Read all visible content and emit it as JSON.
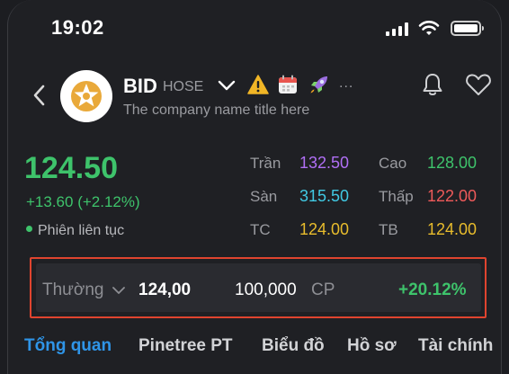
{
  "status_bar": {
    "time": "19:02"
  },
  "header": {
    "ticker": "BID",
    "exchange": "HOSE",
    "company_name": "The company name title here",
    "more": "..."
  },
  "quote": {
    "price": "124.50",
    "change": "+13.60 (+2.12%)",
    "session": "Phiên liên tục",
    "stats": [
      {
        "label": "Trần",
        "value": "132.50"
      },
      {
        "label": "Sàn",
        "value": "315.50"
      },
      {
        "label": "TC",
        "value": "124.00"
      },
      {
        "label": "Cao",
        "value": "128.00"
      },
      {
        "label": "Thấp",
        "value": "122.00"
      },
      {
        "label": "TB",
        "value": "124.00"
      }
    ]
  },
  "order_bar": {
    "type": "Thường",
    "price": "124,00",
    "quantity": "100,000",
    "unit": "CP",
    "percent": "+20.12%"
  },
  "tabs": [
    {
      "label": "Tổng quan",
      "active": true
    },
    {
      "label": "Pinetree PT",
      "active": false
    },
    {
      "label": "Biểu đồ",
      "active": false
    },
    {
      "label": "Hồ sơ",
      "active": false
    },
    {
      "label": "Tài chính",
      "active": false
    }
  ],
  "colors": {
    "up": "#3ec36b",
    "ceiling": "#b06ff5",
    "floor": "#41c9e3",
    "reference": "#e8bc2c",
    "down": "#ef5a5a",
    "active_tab": "#2f95e8",
    "highlight_border": "#e0442f"
  }
}
